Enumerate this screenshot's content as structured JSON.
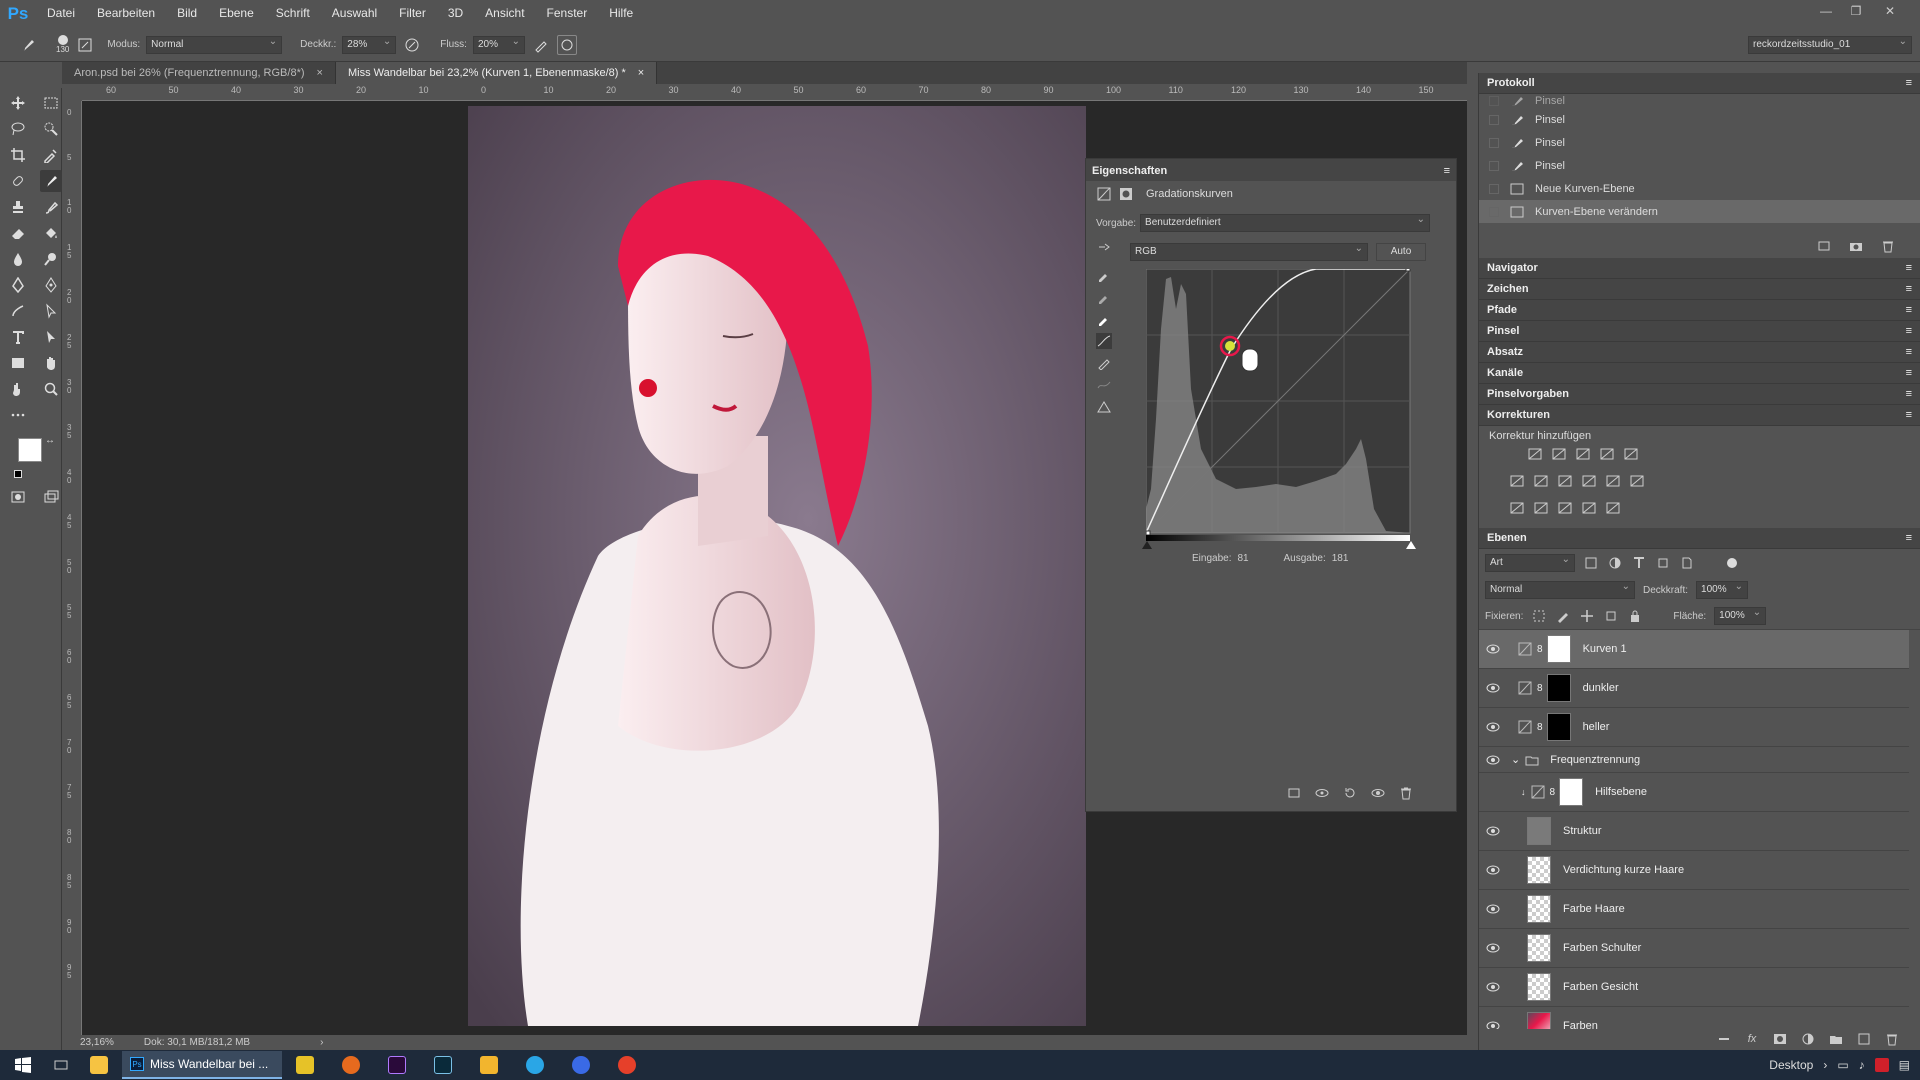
{
  "app": {
    "logo": "Ps"
  },
  "menu": [
    "Datei",
    "Bearbeiten",
    "Bild",
    "Ebene",
    "Schrift",
    "Auswahl",
    "Filter",
    "3D",
    "Ansicht",
    "Fenster",
    "Hilfe"
  ],
  "options": {
    "brush_size": "130",
    "modus_label": "Modus:",
    "modus_value": "Normal",
    "deckkraft_label": "Deckkr.:",
    "deckkraft_value": "28%",
    "fluss_label": "Fluss:",
    "fluss_value": "20%",
    "workspace": "reckordzeitsstudio_01"
  },
  "tabs": [
    {
      "label": "Aron.psd bei 26% (Frequenztrennung, RGB/8*)",
      "close": "×"
    },
    {
      "label": "Miss Wandelbar bei 23,2% (Kurven 1, Ebenenmaske/8) *",
      "close": "×"
    }
  ],
  "ruler_h": [
    "60",
    "50",
    "40",
    "30",
    "20",
    "10",
    "0",
    "10",
    "20",
    "30",
    "40",
    "50",
    "60",
    "70",
    "80",
    "90",
    "100",
    "110",
    "120",
    "130",
    "140",
    "150"
  ],
  "ruler_v": [
    "0",
    "5",
    "1 0",
    "1 5",
    "2 0",
    "2 5",
    "3 0",
    "3 5",
    "4 0",
    "4 5",
    "5 0",
    "5 5",
    "6 0",
    "6 5",
    "7 0",
    "7 5",
    "8 0",
    "8 5",
    "9 0",
    "9 5"
  ],
  "status": {
    "zoom": "23,16%",
    "doc": "Dok: 30,1 MB/181,2 MB",
    "arrow": "›"
  },
  "properties": {
    "title": "Eigenschaften",
    "type": "Gradationskurven",
    "vorgabe_label": "Vorgabe:",
    "vorgabe_value": "Benutzerdefiniert",
    "channel": "RGB",
    "auto": "Auto",
    "eingabe_label": "Eingabe:",
    "eingabe_value": "81",
    "ausgabe_label": "Ausgabe:",
    "ausgabe_value": "181"
  },
  "protokoll": {
    "title": "Protokoll",
    "items": [
      "Pinsel",
      "Pinsel",
      "Pinsel",
      "Pinsel",
      "Neue Kurven-Ebene",
      "Kurven-Ebene verändern"
    ]
  },
  "collapsed_panels": [
    "Navigator",
    "Zeichen",
    "Pfade",
    "Pinsel",
    "Absatz",
    "Kanäle",
    "Pinselvorgaben"
  ],
  "korrekturen": {
    "title": "Korrekturen",
    "subtitle": "Korrektur hinzufügen"
  },
  "ebenen": {
    "title": "Ebenen",
    "filter": "Art",
    "blend": "Normal",
    "deckkraft_label": "Deckkraft:",
    "deckkraft_value": "100%",
    "fixieren_label": "Fixieren:",
    "flaeche_label": "Fläche:",
    "flaeche_value": "100%",
    "layers": [
      {
        "name": "Kurven 1"
      },
      {
        "name": "dunkler"
      },
      {
        "name": "heller"
      },
      {
        "name": "Frequenztrennung"
      },
      {
        "name": "Hilfsebene"
      },
      {
        "name": "Struktur"
      },
      {
        "name": "Verdichtung kurze Haare"
      },
      {
        "name": "Farbe Haare"
      },
      {
        "name": "Farben Schulter"
      },
      {
        "name": "Farben Gesicht"
      },
      {
        "name": "Farben"
      }
    ]
  },
  "taskbar": {
    "active_window": "Miss Wandelbar bei ...",
    "desktop": "Desktop"
  },
  "colors": {
    "hair": "#e8184a",
    "accent": "#31a8ff"
  }
}
